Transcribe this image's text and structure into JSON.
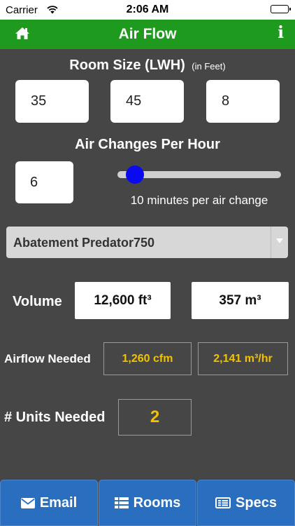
{
  "status": {
    "carrier": "Carrier",
    "time": "2:06 AM"
  },
  "nav": {
    "title": "Air Flow"
  },
  "room_size": {
    "title": "Room Size (LWH)",
    "unit_note": "(in Feet)",
    "length": "35",
    "width": "45",
    "height": "8"
  },
  "air_changes": {
    "title": "Air Changes Per Hour",
    "value": "6",
    "slider_level": 0.05,
    "caption": "10 minutes per air change"
  },
  "equipment": {
    "selected": "Abatement Predator750"
  },
  "volume": {
    "label": "Volume",
    "ft3": "12,600 ft³",
    "m3": "357 m³"
  },
  "airflow": {
    "label": "Airflow Needed",
    "cfm": "1,260 cfm",
    "m3hr": "2,141 m³/hr"
  },
  "units": {
    "label": "# Units Needed",
    "value": "2"
  },
  "toolbar": {
    "email": "Email",
    "rooms": "Rooms",
    "specs": "Specs"
  },
  "colors": {
    "nav_green": "#1e9a1e",
    "accent_yellow": "#f2c200",
    "button_blue": "#2a6ebf",
    "slider_thumb": "#0a0aee"
  }
}
